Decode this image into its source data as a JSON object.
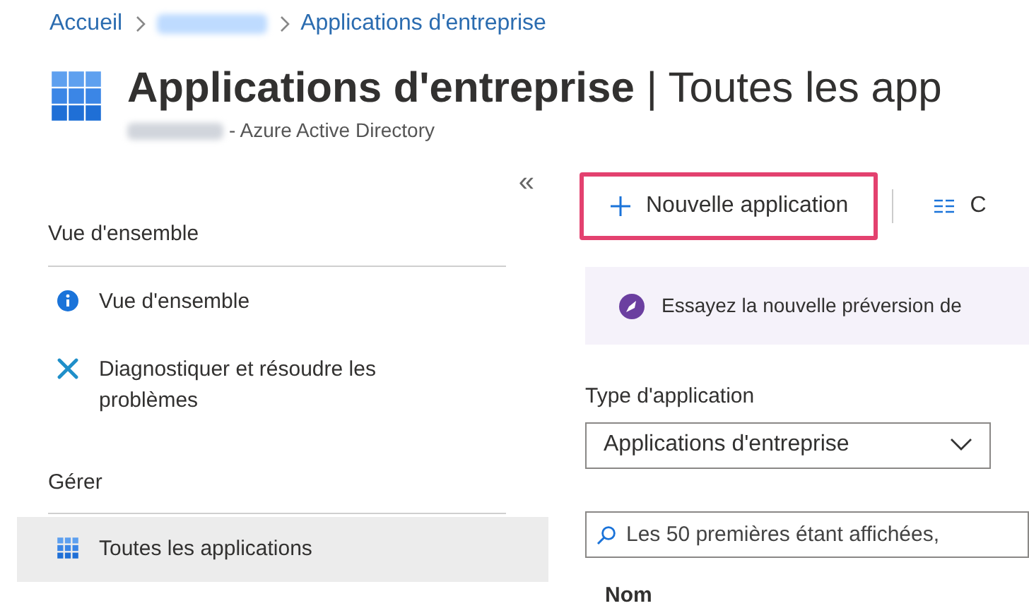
{
  "breadcrumb": [
    {
      "label": "Accueil",
      "kind": "link"
    },
    {
      "kind": "redacted"
    },
    {
      "label": "Applications d'entreprise",
      "kind": "link"
    }
  ],
  "header": {
    "title": "**Applications d'entreprise** | Toutes les app",
    "subtitle": "- Azure Active Directory"
  },
  "sidebar": {
    "collapse": "«",
    "sections": [
      {
        "heading": "Vue d'ensemble",
        "items": [
          {
            "label": "Vue d'ensemble",
            "kind": "info",
            "selected": false
          },
          {
            "label": "Diagnostiquer et résoudre les problèmes",
            "kind": "tools",
            "selected": false
          }
        ]
      },
      {
        "heading": "Gérer",
        "items": [
          {
            "label": "Toutes les applications",
            "kind": "grid",
            "selected": true
          }
        ]
      }
    ]
  },
  "toolbar": [
    {
      "label": "Nouvelle application",
      "kind": "plus",
      "highlighted": true
    },
    {
      "label": "C",
      "kind": "columns",
      "highlighted": false
    }
  ],
  "banner": {
    "text": "Essayez la nouvelle préversion de"
  },
  "filter": {
    "label": "Type d'application",
    "value": "Applications d'entreprise"
  },
  "search": {
    "placeholder": "Les 50 premières étant affichées,"
  },
  "table": {
    "columns": [
      "Nom"
    ]
  }
}
